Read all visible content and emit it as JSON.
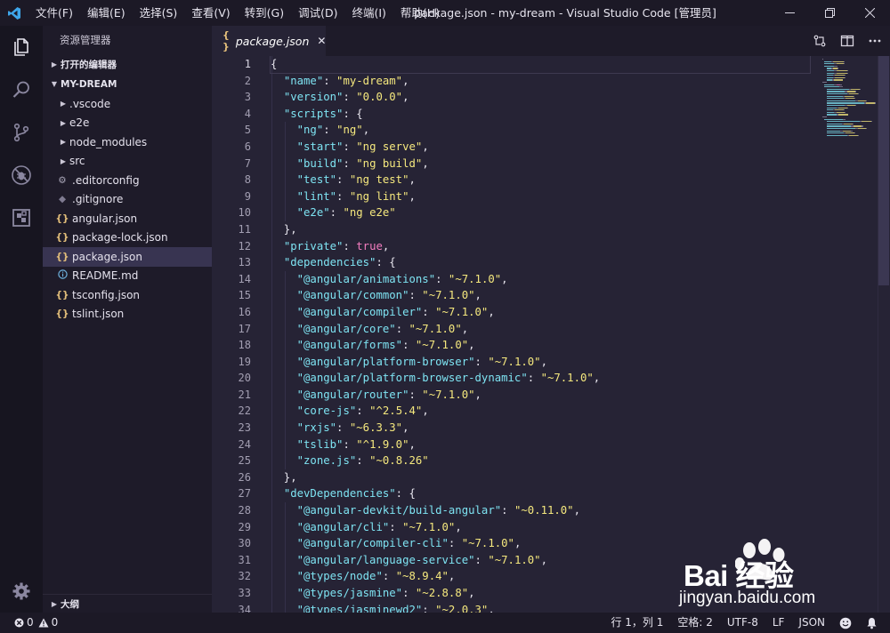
{
  "titlebar": {
    "menu": [
      "文件(F)",
      "编辑(E)",
      "选择(S)",
      "查看(V)",
      "转到(G)",
      "调试(D)",
      "终端(I)",
      "帮助(H)"
    ],
    "window_title": "package.json - my-dream - Visual Studio Code [管理员]",
    "controls": [
      "minimize",
      "restore",
      "close"
    ]
  },
  "activitybar": {
    "icons": [
      "files-icon",
      "search-icon",
      "source-control-icon",
      "debug-icon",
      "extensions-icon"
    ],
    "bottom_icon": "gear-icon"
  },
  "sidebar": {
    "title": "资源管理器",
    "open_editors": "打开的编辑器",
    "project": "MY-DREAM",
    "folders": [
      ".vscode",
      "e2e",
      "node_modules",
      "src"
    ],
    "files": [
      {
        "name": ".editorconfig",
        "icon": "gear"
      },
      {
        "name": ".gitignore",
        "icon": "diamond"
      },
      {
        "name": "angular.json",
        "icon": "json"
      },
      {
        "name": "package-lock.json",
        "icon": "json"
      },
      {
        "name": "package.json",
        "icon": "json",
        "selected": true
      },
      {
        "name": "README.md",
        "icon": "info"
      },
      {
        "name": "tsconfig.json",
        "icon": "json"
      },
      {
        "name": "tslint.json",
        "icon": "json"
      }
    ],
    "outline": "大纲"
  },
  "tabs": [
    {
      "label": "package.json",
      "icon": "{ }",
      "active": true
    }
  ],
  "editor": {
    "line_numbers": [
      "1",
      "2",
      "3",
      "4",
      "5",
      "6",
      "7",
      "8",
      "9",
      "10",
      "11",
      "12",
      "13",
      "14",
      "15",
      "16",
      "17",
      "18",
      "19",
      "20",
      "21",
      "22",
      "23",
      "24",
      "25",
      "26",
      "27",
      "28",
      "29",
      "30",
      "31",
      "32",
      "33",
      "34"
    ],
    "lines": [
      [
        [
          "p",
          "{"
        ]
      ],
      [
        [
          "p",
          "  "
        ],
        [
          "k",
          "\"name\""
        ],
        [
          "p",
          ": "
        ],
        [
          "s",
          "\"my-dream\""
        ],
        [
          "p",
          ","
        ]
      ],
      [
        [
          "p",
          "  "
        ],
        [
          "k",
          "\"version\""
        ],
        [
          "p",
          ": "
        ],
        [
          "s",
          "\"0.0.0\""
        ],
        [
          "p",
          ","
        ]
      ],
      [
        [
          "p",
          "  "
        ],
        [
          "k",
          "\"scripts\""
        ],
        [
          "p",
          ": {"
        ]
      ],
      [
        [
          "p",
          "    "
        ],
        [
          "k",
          "\"ng\""
        ],
        [
          "p",
          ": "
        ],
        [
          "s",
          "\"ng\""
        ],
        [
          "p",
          ","
        ]
      ],
      [
        [
          "p",
          "    "
        ],
        [
          "k",
          "\"start\""
        ],
        [
          "p",
          ": "
        ],
        [
          "s",
          "\"ng serve\""
        ],
        [
          "p",
          ","
        ]
      ],
      [
        [
          "p",
          "    "
        ],
        [
          "k",
          "\"build\""
        ],
        [
          "p",
          ": "
        ],
        [
          "s",
          "\"ng build\""
        ],
        [
          "p",
          ","
        ]
      ],
      [
        [
          "p",
          "    "
        ],
        [
          "k",
          "\"test\""
        ],
        [
          "p",
          ": "
        ],
        [
          "s",
          "\"ng test\""
        ],
        [
          "p",
          ","
        ]
      ],
      [
        [
          "p",
          "    "
        ],
        [
          "k",
          "\"lint\""
        ],
        [
          "p",
          ": "
        ],
        [
          "s",
          "\"ng lint\""
        ],
        [
          "p",
          ","
        ]
      ],
      [
        [
          "p",
          "    "
        ],
        [
          "k",
          "\"e2e\""
        ],
        [
          "p",
          ": "
        ],
        [
          "s",
          "\"ng e2e\""
        ]
      ],
      [
        [
          "p",
          "  },"
        ]
      ],
      [
        [
          "p",
          "  "
        ],
        [
          "k",
          "\"private\""
        ],
        [
          "p",
          ": "
        ],
        [
          "b",
          "true"
        ],
        [
          "p",
          ","
        ]
      ],
      [
        [
          "p",
          "  "
        ],
        [
          "k",
          "\"dependencies\""
        ],
        [
          "p",
          ": {"
        ]
      ],
      [
        [
          "p",
          "    "
        ],
        [
          "k",
          "\"@angular/animations\""
        ],
        [
          "p",
          ": "
        ],
        [
          "s",
          "\"~7.1.0\""
        ],
        [
          "p",
          ","
        ]
      ],
      [
        [
          "p",
          "    "
        ],
        [
          "k",
          "\"@angular/common\""
        ],
        [
          "p",
          ": "
        ],
        [
          "s",
          "\"~7.1.0\""
        ],
        [
          "p",
          ","
        ]
      ],
      [
        [
          "p",
          "    "
        ],
        [
          "k",
          "\"@angular/compiler\""
        ],
        [
          "p",
          ": "
        ],
        [
          "s",
          "\"~7.1.0\""
        ],
        [
          "p",
          ","
        ]
      ],
      [
        [
          "p",
          "    "
        ],
        [
          "k",
          "\"@angular/core\""
        ],
        [
          "p",
          ": "
        ],
        [
          "s",
          "\"~7.1.0\""
        ],
        [
          "p",
          ","
        ]
      ],
      [
        [
          "p",
          "    "
        ],
        [
          "k",
          "\"@angular/forms\""
        ],
        [
          "p",
          ": "
        ],
        [
          "s",
          "\"~7.1.0\""
        ],
        [
          "p",
          ","
        ]
      ],
      [
        [
          "p",
          "    "
        ],
        [
          "k",
          "\"@angular/platform-browser\""
        ],
        [
          "p",
          ": "
        ],
        [
          "s",
          "\"~7.1.0\""
        ],
        [
          "p",
          ","
        ]
      ],
      [
        [
          "p",
          "    "
        ],
        [
          "k",
          "\"@angular/platform-browser-dynamic\""
        ],
        [
          "p",
          ": "
        ],
        [
          "s",
          "\"~7.1.0\""
        ],
        [
          "p",
          ","
        ]
      ],
      [
        [
          "p",
          "    "
        ],
        [
          "k",
          "\"@angular/router\""
        ],
        [
          "p",
          ": "
        ],
        [
          "s",
          "\"~7.1.0\""
        ],
        [
          "p",
          ","
        ]
      ],
      [
        [
          "p",
          "    "
        ],
        [
          "k",
          "\"core-js\""
        ],
        [
          "p",
          ": "
        ],
        [
          "s",
          "\"^2.5.4\""
        ],
        [
          "p",
          ","
        ]
      ],
      [
        [
          "p",
          "    "
        ],
        [
          "k",
          "\"rxjs\""
        ],
        [
          "p",
          ": "
        ],
        [
          "s",
          "\"~6.3.3\""
        ],
        [
          "p",
          ","
        ]
      ],
      [
        [
          "p",
          "    "
        ],
        [
          "k",
          "\"tslib\""
        ],
        [
          "p",
          ": "
        ],
        [
          "s",
          "\"^1.9.0\""
        ],
        [
          "p",
          ","
        ]
      ],
      [
        [
          "p",
          "    "
        ],
        [
          "k",
          "\"zone.js\""
        ],
        [
          "p",
          ": "
        ],
        [
          "s",
          "\"~0.8.26\""
        ]
      ],
      [
        [
          "p",
          "  },"
        ]
      ],
      [
        [
          "p",
          "  "
        ],
        [
          "k",
          "\"devDependencies\""
        ],
        [
          "p",
          ": {"
        ]
      ],
      [
        [
          "p",
          "    "
        ],
        [
          "k",
          "\"@angular-devkit/build-angular\""
        ],
        [
          "p",
          ": "
        ],
        [
          "s",
          "\"~0.11.0\""
        ],
        [
          "p",
          ","
        ]
      ],
      [
        [
          "p",
          "    "
        ],
        [
          "k",
          "\"@angular/cli\""
        ],
        [
          "p",
          ": "
        ],
        [
          "s",
          "\"~7.1.0\""
        ],
        [
          "p",
          ","
        ]
      ],
      [
        [
          "p",
          "    "
        ],
        [
          "k",
          "\"@angular/compiler-cli\""
        ],
        [
          "p",
          ": "
        ],
        [
          "s",
          "\"~7.1.0\""
        ],
        [
          "p",
          ","
        ]
      ],
      [
        [
          "p",
          "    "
        ],
        [
          "k",
          "\"@angular/language-service\""
        ],
        [
          "p",
          ": "
        ],
        [
          "s",
          "\"~7.1.0\""
        ],
        [
          "p",
          ","
        ]
      ],
      [
        [
          "p",
          "    "
        ],
        [
          "k",
          "\"@types/node\""
        ],
        [
          "p",
          ": "
        ],
        [
          "s",
          "\"~8.9.4\""
        ],
        [
          "p",
          ","
        ]
      ],
      [
        [
          "p",
          "    "
        ],
        [
          "k",
          "\"@types/jasmine\""
        ],
        [
          "p",
          ": "
        ],
        [
          "s",
          "\"~2.8.8\""
        ],
        [
          "p",
          ","
        ]
      ],
      [
        [
          "p",
          "    "
        ],
        [
          "k",
          "\"@types/jasminewd2\""
        ],
        [
          "p",
          ": "
        ],
        [
          "s",
          "\"~2.0.3\""
        ],
        [
          "p",
          ","
        ]
      ]
    ]
  },
  "statusbar": {
    "errors": "0",
    "warnings": "0",
    "position": "行 1，列 1",
    "spaces": "空格: 2",
    "encoding": "UTF-8",
    "eol": "LF",
    "language": "JSON"
  },
  "watermark": {
    "brand": "Bai 经验",
    "url": "jingyan.baidu.com"
  },
  "colors": {
    "key": "#7ee3f2",
    "string": "#f5e87e",
    "boolean": "#f57ec1",
    "background": "#262335"
  }
}
